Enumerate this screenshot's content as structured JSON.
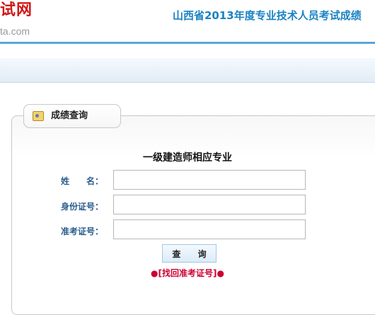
{
  "header": {
    "logo_main": "试网",
    "logo_sub": "ta.com",
    "site_title": "山西省2013年度专业技术人员考试成绩"
  },
  "panel": {
    "tab_label": "成绩查询",
    "tab_icon": "id-card-icon",
    "form_title": "一级建造师相应专业",
    "fields": [
      {
        "label": "姓　　名：",
        "value": "",
        "placeholder": ""
      },
      {
        "label": "身份证号：",
        "value": "",
        "placeholder": ""
      },
      {
        "label": "准考证号：",
        "value": "",
        "placeholder": ""
      }
    ],
    "query_button": "查 询",
    "retrieve_link": "[找回准考证号]",
    "bullet": "●"
  },
  "colors": {
    "brand_red": "#d01818",
    "title_blue": "#1a82c4",
    "label_blue": "#2a5d8f",
    "link_red": "#cc0033"
  }
}
